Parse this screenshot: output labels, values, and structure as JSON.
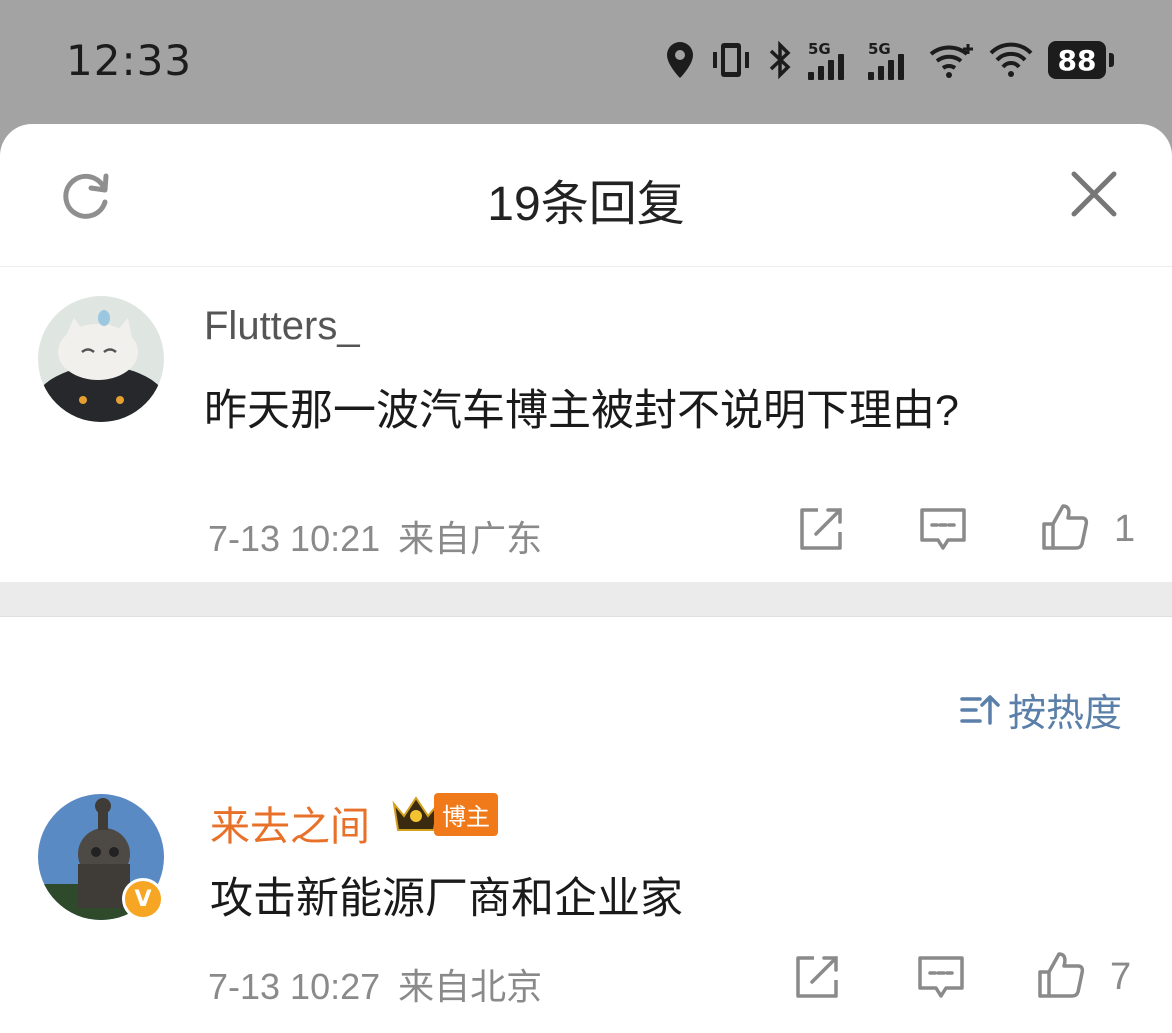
{
  "status_bar": {
    "time": "12:33",
    "network_label_1": "5G",
    "network_label_2": "5G",
    "battery": "88",
    "icons": [
      "location-icon",
      "vibrate-icon",
      "bluetooth-icon",
      "signal-5g-icon",
      "signal-5g-icon",
      "wifi-icon",
      "wifi-icon",
      "battery-icon"
    ]
  },
  "sheet": {
    "title": "19条回复",
    "refresh_icon": "refresh-icon",
    "close_icon": "close-icon"
  },
  "root_comment": {
    "username": "Flutters_",
    "text": "昨天那一波汽车博主被封不说明下理由?",
    "time": "7-13 10:21",
    "location": "来自广东",
    "like_count": "1",
    "username_color": "#555555"
  },
  "sort": {
    "label": "按热度",
    "icon": "sort-icon"
  },
  "replies": [
    {
      "username": "来去之间",
      "badge_text": "博主",
      "text": "攻击新能源厂商和企业家",
      "time": "7-13 10:27",
      "location": "来自北京",
      "like_count": "7",
      "username_color": "#e8712a",
      "verified": "V"
    }
  ],
  "colors": {
    "accent_blue": "#5a7fa8",
    "orange": "#e8712a",
    "meta_gray": "#8a8a8a"
  }
}
